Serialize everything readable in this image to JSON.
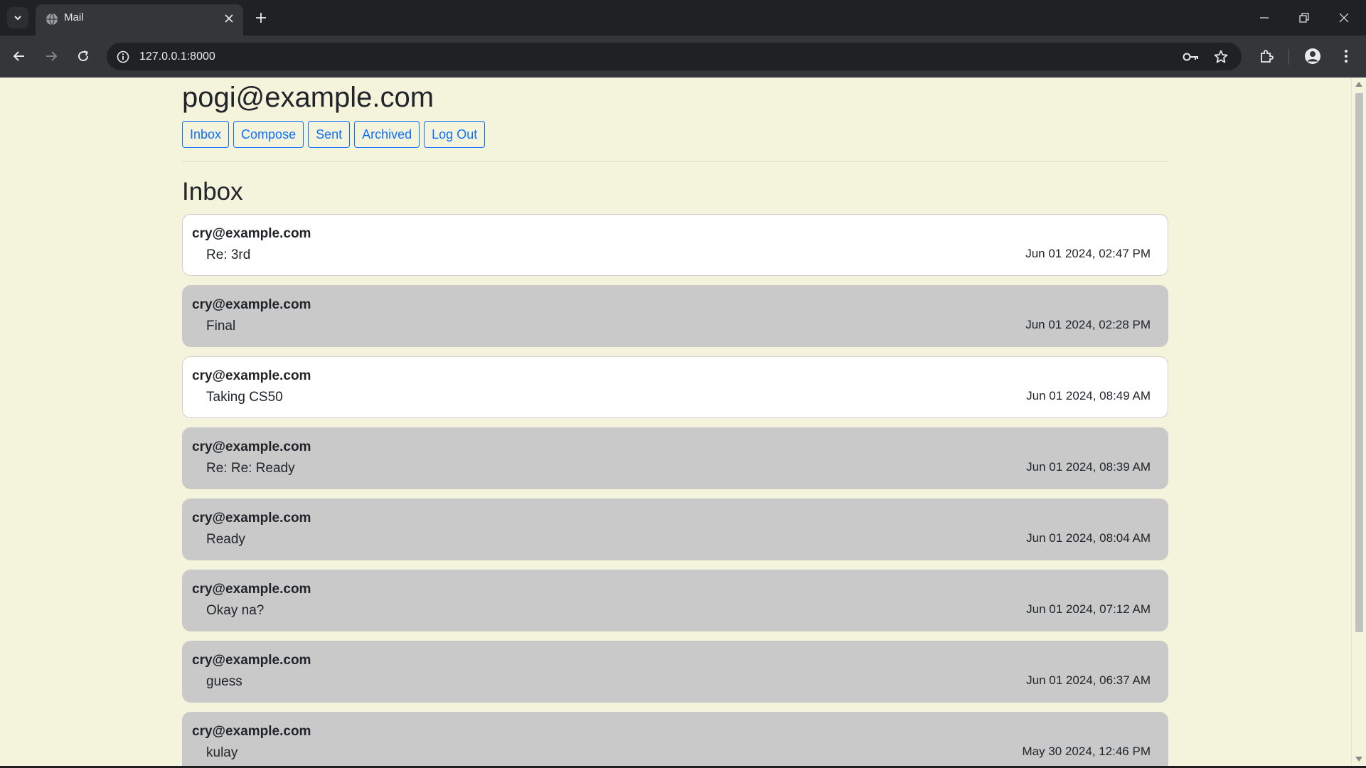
{
  "browser": {
    "tab_title": "Mail",
    "url": "127.0.0.1:8000",
    "icons": {
      "tab_search": "chevron-down-icon",
      "favicon": "globe-icon",
      "tab_close": "close-icon",
      "new_tab": "plus-icon",
      "back": "arrow-left-icon",
      "forward": "arrow-right-icon",
      "reload": "reload-icon",
      "site_info": "info-icon",
      "passwords": "key-icon",
      "bookmark": "star-icon",
      "extensions": "puzzle-icon",
      "profile": "person-icon",
      "menu": "kebab-icon"
    }
  },
  "page": {
    "user_email": "pogi@example.com",
    "nav": {
      "inbox": "Inbox",
      "compose": "Compose",
      "sent": "Sent",
      "archived": "Archived",
      "logout": "Log Out"
    },
    "mailbox_title": "Inbox",
    "emails": [
      {
        "sender": "cry@example.com",
        "subject": "Re: 3rd",
        "timestamp": "Jun 01 2024, 02:47 PM",
        "read": false
      },
      {
        "sender": "cry@example.com",
        "subject": "Final",
        "timestamp": "Jun 01 2024, 02:28 PM",
        "read": true
      },
      {
        "sender": "cry@example.com",
        "subject": "Taking CS50",
        "timestamp": "Jun 01 2024, 08:49 AM",
        "read": false
      },
      {
        "sender": "cry@example.com",
        "subject": "Re: Re: Ready",
        "timestamp": "Jun 01 2024, 08:39 AM",
        "read": true
      },
      {
        "sender": "cry@example.com",
        "subject": "Ready",
        "timestamp": "Jun 01 2024, 08:04 AM",
        "read": true
      },
      {
        "sender": "cry@example.com",
        "subject": "Okay na?",
        "timestamp": "Jun 01 2024, 07:12 AM",
        "read": true
      },
      {
        "sender": "cry@example.com",
        "subject": "guess",
        "timestamp": "Jun 01 2024, 06:37 AM",
        "read": true
      },
      {
        "sender": "cry@example.com",
        "subject": "kulay",
        "timestamp": "May 30 2024, 12:46 PM",
        "read": true
      }
    ]
  },
  "colors": {
    "page_background": "#f4f4dc",
    "unread_email": "#ffffff",
    "read_email": "#c9c9c9",
    "nav_button": "#0d6efd"
  }
}
